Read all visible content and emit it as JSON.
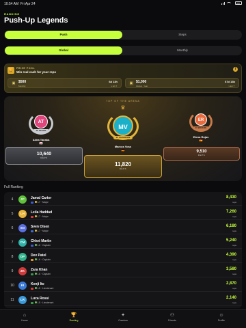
{
  "status_bar": {
    "time": "10:54 AM",
    "date": "Fri Apr 24",
    "battery": ""
  },
  "header": {
    "eyebrow": "RANKING",
    "title": "Push-Up Legends"
  },
  "exercise_toggle": {
    "options": [
      "Push",
      "Steps"
    ],
    "selected": "Push"
  },
  "scope_toggle": {
    "options": [
      "Global",
      "Monthly"
    ],
    "selected": "Global"
  },
  "prize_pool": {
    "label": "PRIZE POOL",
    "text": "Win real cash for your reps",
    "icon": "trophy-icon",
    "cards": [
      {
        "amount": "$500",
        "period": "Monthly",
        "countdown": "6d 13h",
        "left_label": "LEFT"
      },
      {
        "amount": "$1,000",
        "period": "Global · Year",
        "countdown": "67d 13h",
        "left_label": "LEFT"
      }
    ]
  },
  "arena": {
    "title": "TOP OF THE ARENA",
    "podium": [
      {
        "rank_label": "#2 SILVER",
        "initials": "AT",
        "name": "Akira Tanaka",
        "flag": "🇯🇵",
        "value": "10,640",
        "unit": "REPS",
        "color": "#e0457b",
        "medal": "#c9cbd0"
      },
      {
        "rank_label": "#1 CHAMPION",
        "initials": "MV",
        "name": "Marcus Voss",
        "flag": "🇩🇪",
        "value": "11,820",
        "unit": "REPS",
        "color": "#1bb0c9",
        "medal": "#e3b53a"
      },
      {
        "rank_label": "#3 BRONZE",
        "initials": "ER",
        "name": "Elena Rojas",
        "flag": "🇪🇸",
        "value": "9,510",
        "unit": "REPS",
        "color": "#ea6a3c",
        "medal": "#c87a4a"
      }
    ]
  },
  "full_ranking": {
    "label": "Full Ranking",
    "rows": [
      {
        "rank": "4",
        "initials": "JC",
        "name": "Jamal Carter",
        "level": "L7 · Major",
        "value": "8,430",
        "unit": "reps",
        "color": "#5fc23a",
        "flag": "#3b5bdb",
        "tier": "#e6c03a"
      },
      {
        "rank": "5",
        "initials": "LH",
        "name": "Leila Haddad",
        "level": "L7 · Major",
        "value": "7,260",
        "unit": "reps",
        "color": "#e8b43a",
        "flag": "#d93a3a",
        "tier": "#e6c03a"
      },
      {
        "rank": "6",
        "initials": "SO",
        "name": "Sven Olsen",
        "level": "L7 · Major",
        "value": "6,180",
        "unit": "reps",
        "color": "#5a6fe0",
        "flag": "#3b6ad9",
        "tier": "#e6c03a"
      },
      {
        "rank": "7",
        "initials": "CM",
        "name": "Chloé Martin",
        "level": "L6 · Captain",
        "value": "5,240",
        "unit": "reps",
        "color": "#2fb3a8",
        "flag": "#3b5bdb",
        "tier": "#6fc25a"
      },
      {
        "rank": "8",
        "initials": "DP",
        "name": "Dev Patel",
        "level": "L6 · Captain",
        "value": "4,390",
        "unit": "reps",
        "color": "#2fb38a",
        "flag": "#e8952e",
        "tier": "#6fc25a"
      },
      {
        "rank": "9",
        "initials": "ZK",
        "name": "Zara Khan",
        "level": "L6 · Captain",
        "value": "3,580",
        "unit": "reps",
        "color": "#d13a3a",
        "flag": "#3b9a4a",
        "tier": "#6fc25a"
      },
      {
        "rank": "10",
        "initials": "KI",
        "name": "Kenji Ito",
        "level": "L5 · Lieutenant",
        "value": "2,870",
        "unit": "reps",
        "color": "#3a7ad9",
        "flag": "#d93a3a",
        "tier": "#6fc25a"
      },
      {
        "rank": "11",
        "initials": "LR",
        "name": "Luca Rossi",
        "level": "L5 · Lieutenant",
        "value": "2,140",
        "unit": "reps",
        "color": "#3a9ad9",
        "flag": "#3b9a4a",
        "tier": "#6fc25a"
      }
    ]
  },
  "tab_bar": {
    "tabs": [
      {
        "label": "Home",
        "icon": "home-icon",
        "glyph": "⌂"
      },
      {
        "label": "Ranking",
        "icon": "trophy-icon",
        "glyph": "🏆"
      },
      {
        "label": "Coaches",
        "icon": "dumbbell-icon",
        "glyph": "✦"
      },
      {
        "label": "Friends",
        "icon": "friends-icon",
        "glyph": "⚇"
      },
      {
        "label": "Profile",
        "icon": "profile-icon",
        "glyph": "☺"
      }
    ],
    "selected": "Ranking"
  },
  "accent": "#c6ff3c"
}
